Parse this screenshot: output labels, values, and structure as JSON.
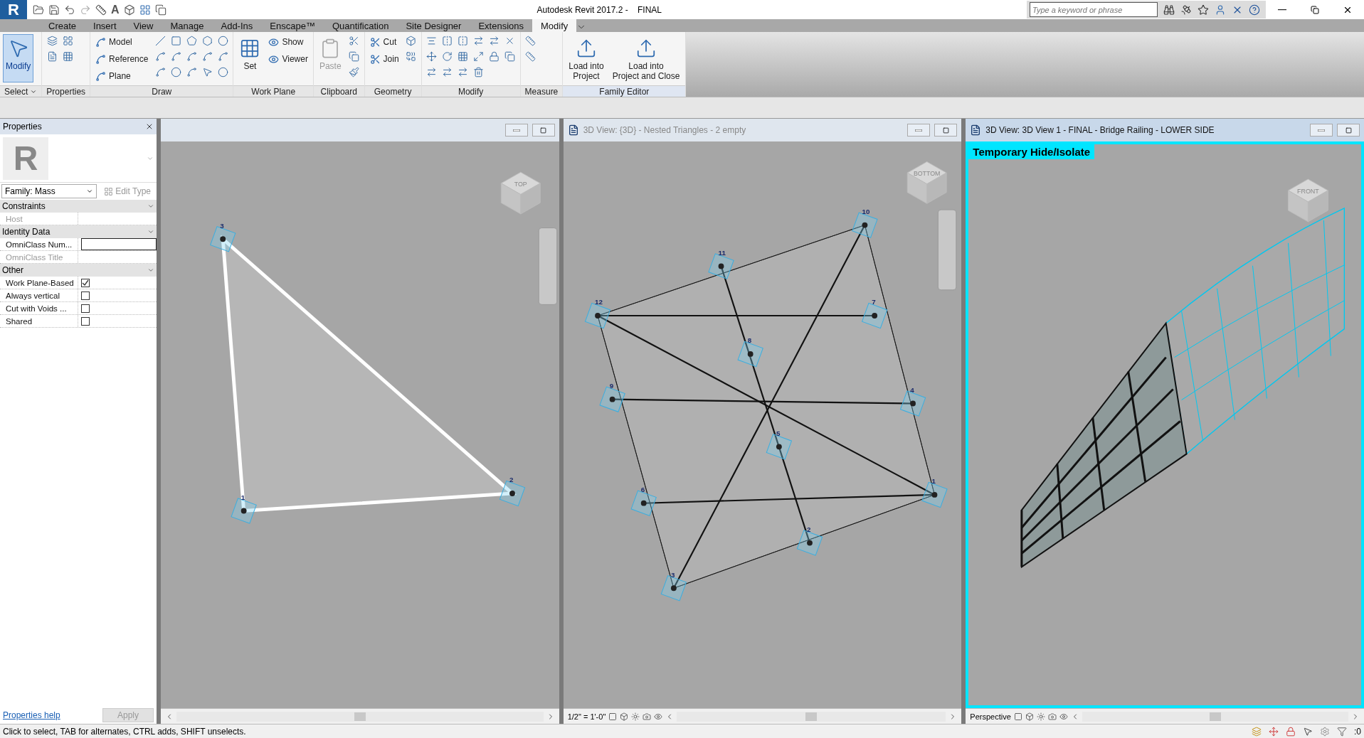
{
  "app": {
    "logo": "R",
    "text_tool_glyph": "A",
    "title": "Autodesk Revit 2017.2 -    FINAL",
    "search_placeholder": "Type a keyword or phrase"
  },
  "ribbon_tabs": [
    {
      "label": "Create",
      "selected": false
    },
    {
      "label": "Insert",
      "selected": false
    },
    {
      "label": "View",
      "selected": false
    },
    {
      "label": "Manage",
      "selected": false
    },
    {
      "label": "Add-Ins",
      "selected": false
    },
    {
      "label": "Enscape™",
      "selected": false
    },
    {
      "label": "Quantification",
      "selected": false
    },
    {
      "label": "Site Designer",
      "selected": false
    },
    {
      "label": "Extensions",
      "selected": false
    },
    {
      "label": "Modify",
      "selected": true
    }
  ],
  "ribbon_panels": [
    {
      "kind": "select",
      "label": "Select",
      "buttons": [
        {
          "kind": "large",
          "label": "Modify",
          "selected": true,
          "disabled": false
        }
      ]
    },
    {
      "kind": "properties",
      "label": "Properties"
    },
    {
      "kind": "draw",
      "label": "Draw",
      "buttons": [
        {
          "kind": "small",
          "label": "Model",
          "disabled": false
        },
        {
          "kind": "small",
          "label": "Reference",
          "disabled": false
        },
        {
          "kind": "small",
          "label": "Plane",
          "disabled": false
        }
      ]
    },
    {
      "kind": "workplane",
      "label": "Work Plane",
      "buttons": [
        {
          "kind": "large",
          "label": "Set",
          "disabled": false
        },
        {
          "kind": "small",
          "label": "Show",
          "disabled": false
        },
        {
          "kind": "small",
          "label": "Viewer",
          "disabled": false
        }
      ]
    },
    {
      "kind": "clipboard",
      "label": "Clipboard",
      "buttons": [
        {
          "kind": "large",
          "label": "Paste",
          "disabled": true
        }
      ]
    },
    {
      "kind": "geometry",
      "label": "Geometry",
      "buttons": [
        {
          "kind": "small",
          "label": "Cut",
          "disabled": false
        },
        {
          "kind": "small",
          "label": "Join",
          "disabled": false
        }
      ]
    },
    {
      "kind": "modify",
      "label": "Modify"
    },
    {
      "kind": "measure",
      "label": "Measure"
    },
    {
      "kind": "family",
      "label": "Family Editor",
      "buttons": [
        {
          "kind": "large",
          "label": "Load into\nProject",
          "disabled": false
        },
        {
          "kind": "large",
          "label": "Load into\nProject and Close",
          "disabled": false
        }
      ]
    }
  ],
  "properties": {
    "title": "Properties",
    "type_preview": "R",
    "type_selector": "Family: Mass",
    "edit_type": "Edit Type",
    "groups": [
      {
        "label": "Constraints",
        "rows": [
          {
            "kind": "text",
            "label": "Host",
            "disabled": true
          }
        ]
      },
      {
        "label": "Identity Data",
        "rows": [
          {
            "kind": "input",
            "label": "OmniClass Num...",
            "disabled": false
          },
          {
            "kind": "text",
            "label": "OmniClass Title",
            "disabled": true
          }
        ]
      },
      {
        "label": "Other",
        "rows": [
          {
            "kind": "checkbox",
            "label": "Work Plane-Based",
            "checked": true,
            "disabled": false
          },
          {
            "kind": "checkbox",
            "label": "Always vertical",
            "checked": false,
            "disabled": false
          },
          {
            "kind": "checkbox",
            "label": "Cut with Voids ...",
            "checked": false,
            "disabled": false
          },
          {
            "kind": "checkbox",
            "label": "Shared",
            "checked": false,
            "disabled": false
          }
        ]
      }
    ],
    "help_link": "Properties help",
    "apply": "Apply"
  },
  "views": [
    {
      "kind": "triangle",
      "active": false,
      "cube_label": "TOP",
      "points": [
        {
          "label": "3"
        },
        {
          "label": "1"
        },
        {
          "label": "2"
        }
      ]
    },
    {
      "kind": "grid",
      "title": "3D View: {3D} - Nested Triangles - 2 empty",
      "active": false,
      "cube_label": "BOTTOM",
      "scale": "1/2\" = 1'-0\"",
      "points": [
        {
          "label": "10"
        },
        {
          "label": "11"
        },
        {
          "label": "12"
        },
        {
          "label": "7"
        },
        {
          "label": "8"
        },
        {
          "label": "9"
        },
        {
          "label": "4"
        },
        {
          "label": "5"
        },
        {
          "label": "6"
        },
        {
          "label": "1"
        },
        {
          "label": "2"
        },
        {
          "label": "3"
        }
      ]
    },
    {
      "kind": "railing",
      "title": "3D View: 3D View 1 - FINAL - Bridge Railing - LOWER SIDE",
      "active": true,
      "banner": "Temporary Hide/Isolate",
      "cube_label": "FRONT",
      "scale": "Perspective"
    }
  ],
  "status_bar": {
    "message": "Click to select, TAB for alternates, CTRL adds, SHIFT unselects.",
    "filter_count": ":0"
  }
}
